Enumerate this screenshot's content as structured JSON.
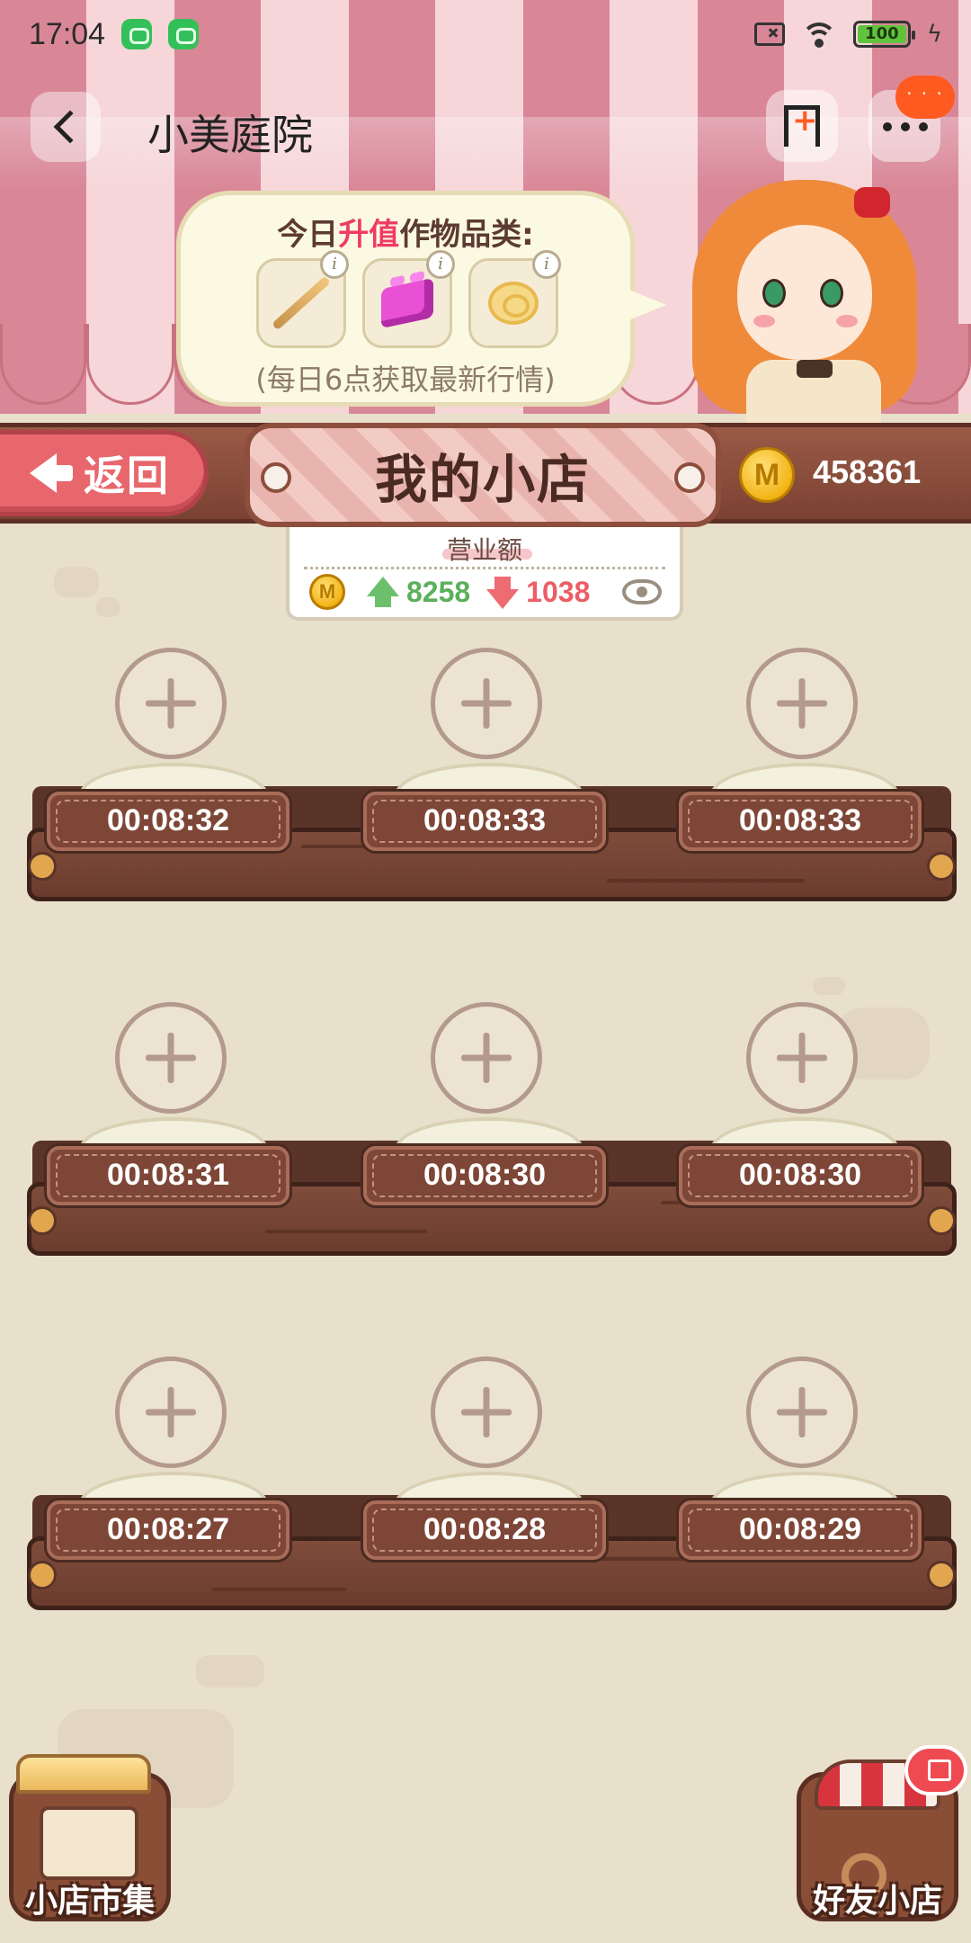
{
  "status_bar": {
    "time": "17:04",
    "battery": "100"
  },
  "header": {
    "title": "小美庭院"
  },
  "notification": {
    "dots": "· · ·"
  },
  "bubble": {
    "title_prefix": "今日",
    "title_highlight": "升值",
    "title_suffix": "作物品类:",
    "note": "(每日6点获取最新行情)",
    "info_glyph": "i",
    "crops": [
      "stick-crop-icon",
      "pink-block-crop-icon",
      "yellow-swirl-crop-icon"
    ]
  },
  "shop": {
    "return_label": "返回",
    "title": "我的小店",
    "coin_glyph": "M",
    "coins": "458361"
  },
  "revenue": {
    "label": "营业额",
    "up": "8258",
    "down": "1038"
  },
  "shelves": [
    {
      "timers": [
        "00:08:32",
        "00:08:33",
        "00:08:33"
      ]
    },
    {
      "timers": [
        "00:08:31",
        "00:08:30",
        "00:08:30"
      ]
    },
    {
      "timers": [
        "00:08:27",
        "00:08:28",
        "00:08:29"
      ]
    }
  ],
  "footer": {
    "market_label": "小店市集",
    "friend_label": "好友小店"
  },
  "colors": {
    "accent": "#ef3b63",
    "return_button": "#e8676d",
    "shelf_wood": "#7f4c3b",
    "background": "#e8e0cb",
    "awning_stripe": "#d98797"
  }
}
